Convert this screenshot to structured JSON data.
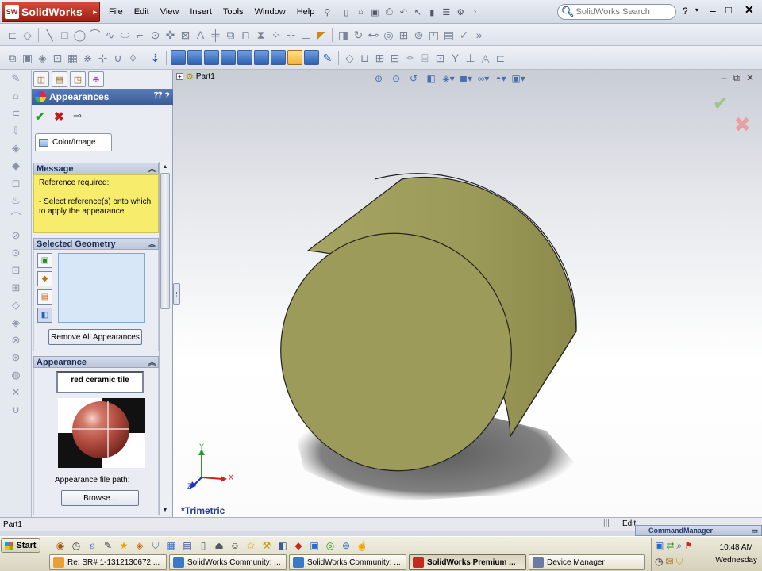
{
  "app": {
    "logo_text": "SolidWorks",
    "logo_badge": "SW",
    "menu": [
      "File",
      "Edit",
      "View",
      "Insert",
      "Tools",
      "Window",
      "Help"
    ],
    "search_placeholder": "SolidWorks Search",
    "help_label": "?"
  },
  "tree": {
    "root": "Part1"
  },
  "panel": {
    "title": "Appearances",
    "tab": "Color/Image",
    "message": {
      "header": "Message",
      "line1": "Reference required:",
      "line2": "- Select reference(s) onto which to apply the appearance."
    },
    "geometry": {
      "header": "Selected Geometry",
      "remove_button": "Remove All Appearances"
    },
    "appearance": {
      "header": "Appearance",
      "name": "red ceramic tile",
      "path_label": "Appearance file path:",
      "browse_button": "Browse..."
    }
  },
  "graphics": {
    "view_name": "*Trimetric",
    "model_color": "#9d9b5a",
    "triad": {
      "x": "X",
      "y": "Y",
      "z": "Z"
    }
  },
  "status": {
    "left": "Part1",
    "right": "Edit"
  },
  "command_manager": "CommandManager",
  "taskbar": {
    "start": "Start",
    "tasks": [
      {
        "label": "Re: SR# 1-1312130672 ...",
        "color": "#e8a030",
        "active": false
      },
      {
        "label": "SolidWorks Community: ...",
        "color": "#3a78c8",
        "active": false
      },
      {
        "label": "SolidWorks Community: ...",
        "color": "#3a78c8",
        "active": false
      },
      {
        "label": "SolidWorks Premium ...",
        "color": "#c42a1e",
        "active": true
      },
      {
        "label": "Device Manager",
        "color": "#6a7aa0",
        "active": false
      }
    ],
    "time": "10:48 AM",
    "day": "Wednesday"
  }
}
